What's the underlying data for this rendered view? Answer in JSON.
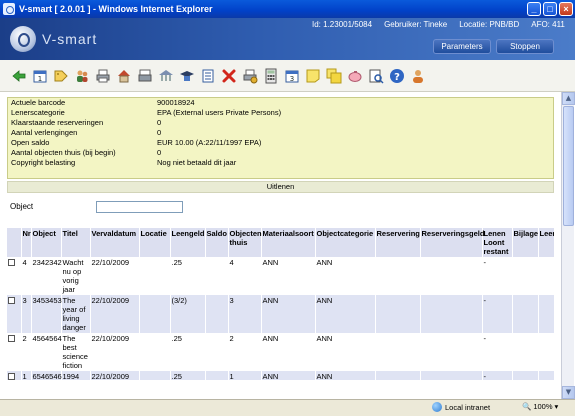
{
  "window": {
    "title": "V-smart [ 2.0.01 ] - Windows Internet Explorer"
  },
  "header": {
    "logo_text": "V-smart",
    "id_label": "Id: 1.23001/5084",
    "user_label": "Gebruiker: Tineke",
    "location_label": "Locatie: PNB/BD",
    "afo_label": "AFO: 411",
    "parameters_button": "Parameters",
    "stop_button": "Stoppen"
  },
  "toolbar": {
    "icons": [
      "back-arrow-icon",
      "calendar-icon",
      "tag-icon",
      "users-icon",
      "print-icon",
      "house-icon",
      "card-print-icon",
      "library-icon",
      "student-icon",
      "list-icon",
      "delete-icon",
      "print-settings-icon",
      "calculator-icon",
      "calendar-3-icon",
      "note-icon",
      "notes-icon",
      "piggy-bank-icon",
      "preview-icon",
      "help-icon",
      "person-icon"
    ]
  },
  "info": {
    "rows": [
      {
        "label": "Actuele barcode",
        "value": "900018924"
      },
      {
        "label": "Lenerscategorie",
        "value": "EPA (External users Private Persons)"
      },
      {
        "label": "Klaarstaande reserveringen",
        "value": "0"
      },
      {
        "label": "Aantal verlengingen",
        "value": "0"
      },
      {
        "label": "Open saldo",
        "value": "EUR 10.00 (A:22/11/1997 EPA)"
      },
      {
        "label": "Aantal objecten thuis (bij begin)",
        "value": "0"
      },
      {
        "label": "Copyright belasting",
        "value": "Nog niet betaald dit jaar"
      }
    ]
  },
  "section": {
    "title": "Uitlenen",
    "object_label": "Object",
    "object_value": ""
  },
  "grid": {
    "columns": [
      "",
      "Nr",
      "Object",
      "Titel",
      "Vervaldatum",
      "Locatie",
      "Leengeld",
      "Saldo",
      "Objecten thuis",
      "Materiaalsoort",
      "Objectcategorie",
      "Reservering",
      "Reserveringsgeld",
      "Lenen Loont restant",
      "Bijlage",
      "Leenbe"
    ],
    "rows": [
      {
        "nr": "4",
        "object": "2342342",
        "titel": "Wacht nu op vorig jaar",
        "vervaldatum": "22/10/2009",
        "locatie": "",
        "leengeld": ".25",
        "saldo": "",
        "thuis": "4",
        "materiaal": "ANN",
        "categorie": "ANN",
        "reservering": "",
        "resgeld": "",
        "restant": "-",
        "bijlage": "",
        "leenbe": ""
      },
      {
        "nr": "3",
        "object": "3453453",
        "titel": "The year of living danger",
        "vervaldatum": "22/10/2009",
        "locatie": "",
        "leengeld": "(3/2)",
        "saldo": "",
        "thuis": "3",
        "materiaal": "ANN",
        "categorie": "ANN",
        "reservering": "",
        "resgeld": "",
        "restant": "-",
        "bijlage": "",
        "leenbe": ""
      },
      {
        "nr": "2",
        "object": "4564564",
        "titel": "The best science fiction",
        "vervaldatum": "22/10/2009",
        "locatie": "",
        "leengeld": ".25",
        "saldo": "",
        "thuis": "2",
        "materiaal": "ANN",
        "categorie": "ANN",
        "reservering": "",
        "resgeld": "",
        "restant": "-",
        "bijlage": "",
        "leenbe": ""
      },
      {
        "nr": "1",
        "object": "6546546",
        "titel": "1994",
        "vervaldatum": "22/10/2009",
        "locatie": "",
        "leengeld": ".25",
        "saldo": "",
        "thuis": "1",
        "materiaal": "ANN",
        "categorie": "ANN",
        "reservering": "",
        "resgeld": "",
        "restant": "-",
        "bijlage": "",
        "leenbe": ""
      }
    ]
  },
  "statusbar": {
    "zone": "Local intranet",
    "zoom": "100%"
  }
}
